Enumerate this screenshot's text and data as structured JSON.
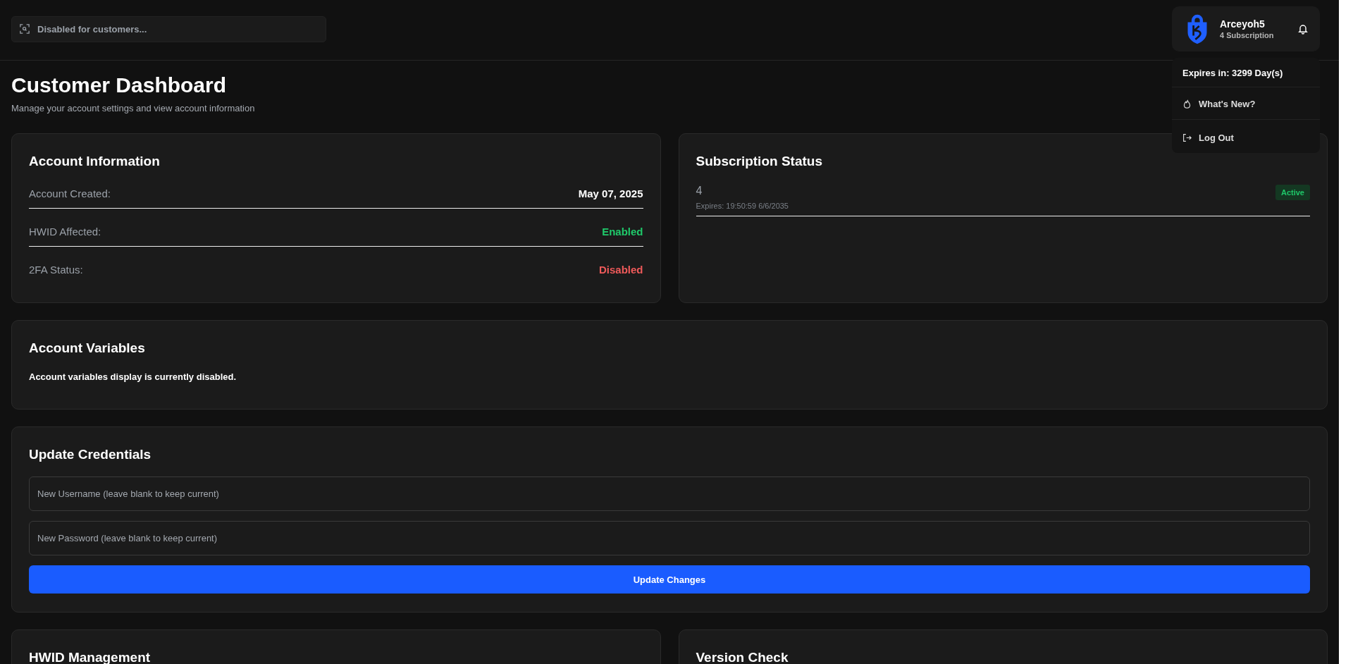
{
  "search": {
    "placeholder": "Disabled for customers..."
  },
  "profile": {
    "name": "Arceyoh5",
    "subtitle": "4 Subscription"
  },
  "menu": {
    "expires": "Expires in: 3299 Day(s)",
    "items": [
      {
        "kind": "news",
        "label": "What's New?"
      },
      {
        "kind": "logout",
        "label": "Log Out"
      }
    ]
  },
  "header": {
    "title": "Customer Dashboard",
    "subtitle": "Manage your account settings and view account information"
  },
  "account_information": {
    "title": "Account Information",
    "rows": [
      {
        "label": "Account Created:",
        "value": "May 07, 2025",
        "color": "#ffffff"
      },
      {
        "label": "HWID Affected:",
        "value": "Enabled",
        "color": "#1fc96a"
      },
      {
        "label": "2FA Status:",
        "value": "Disabled",
        "color": "#ef5a5a"
      }
    ]
  },
  "subscription_status": {
    "title": "Subscription Status",
    "items": [
      {
        "name": "4",
        "expires": "Expires: 19:50:59 6/6/2035",
        "badge": "Active"
      }
    ]
  },
  "account_variables": {
    "title": "Account Variables",
    "message": "Account variables display is currently disabled."
  },
  "update_credentials": {
    "title": "Update Credentials",
    "fields": [
      {
        "placeholder": "New Username (leave blank to keep current)"
      },
      {
        "placeholder": "New Password (leave blank to keep current)"
      }
    ],
    "button": "Update Changes"
  },
  "bottom_cards": [
    {
      "title": "HWID Management"
    },
    {
      "title": "Version Check"
    }
  ]
}
